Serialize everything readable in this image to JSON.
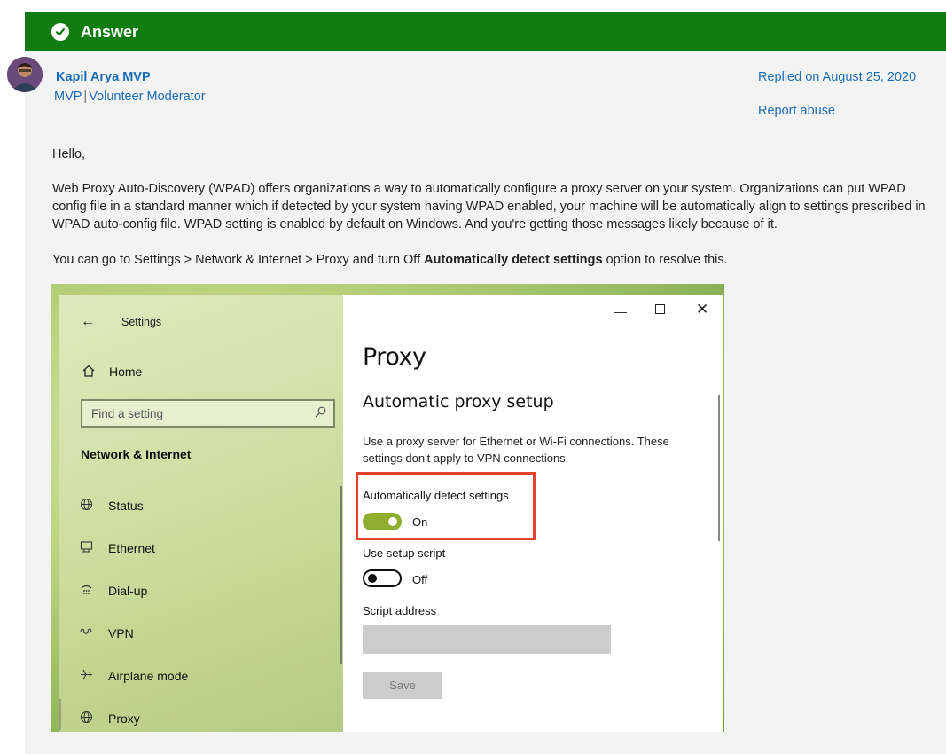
{
  "banner": {
    "label": "Answer"
  },
  "author": {
    "name": "Kapil Arya MVP",
    "role1": "MVP",
    "separator": "|",
    "role2": "Volunteer Moderator"
  },
  "meta": {
    "replied": "Replied on August 25, 2020",
    "report": "Report abuse"
  },
  "post": {
    "greeting": "Hello,",
    "paragraph": "Web Proxy Auto-Discovery (WPAD) offers organizations a way to automatically configure a proxy server on your system. Organizations can put WPAD config file in a standard manner which if detected by your system having WPAD enabled, your machine will be automatically align to settings prescribed in WPAD auto-config file. WPAD setting is enabled by default on Windows. And you're getting those messages likely because of it.",
    "instruction_prefix": "You can go to Settings > Network & Internet > Proxy and turn Off ",
    "instruction_bold": "Automatically detect settings",
    "instruction_suffix": " option to resolve this."
  },
  "settings_window": {
    "app_title": "Settings",
    "home": "Home",
    "search_placeholder": "Find a setting",
    "section": "Network & Internet",
    "nav": [
      {
        "label": "Status",
        "icon": "globe-icon"
      },
      {
        "label": "Ethernet",
        "icon": "ethernet-icon"
      },
      {
        "label": "Dial-up",
        "icon": "dialup-icon"
      },
      {
        "label": "VPN",
        "icon": "vpn-icon"
      },
      {
        "label": "Airplane mode",
        "icon": "airplane-icon"
      },
      {
        "label": "Proxy",
        "icon": "globe-icon"
      }
    ],
    "page_title": "Proxy",
    "subheading": "Automatic proxy setup",
    "description": "Use a proxy server for Ethernet or Wi-Fi connections. These settings don't apply to VPN connections.",
    "auto_detect_label": "Automatically detect settings",
    "auto_detect_state": "On",
    "setup_script_label": "Use setup script",
    "setup_script_state": "Off",
    "script_address_label": "Script address",
    "save_label": "Save"
  },
  "colors": {
    "banner": "#107c10",
    "link": "#1a6cb4",
    "toggle_on": "#8fae2e",
    "highlight": "#e3442b"
  }
}
